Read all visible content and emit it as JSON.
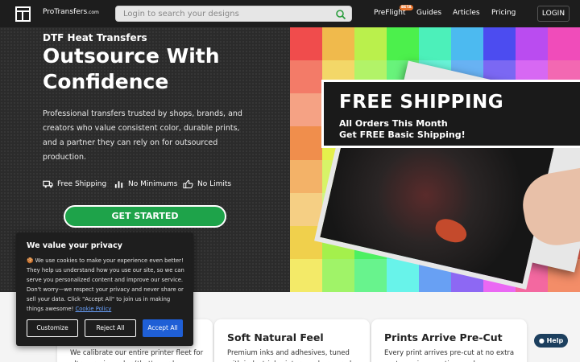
{
  "nav": {
    "logo": "ProTransfers",
    "logo_suffix": ".com",
    "search_placeholder": "Login to search your designs",
    "links": [
      "PreFlight",
      "Guides",
      "Articles",
      "Pricing"
    ],
    "beta_badge": "BETA",
    "login": "LOGIN"
  },
  "hero": {
    "eyebrow": "DTF Heat Transfers",
    "headline": "Outsource With Confidence",
    "description": "Professional transfers trusted by shops, brands, and creators who value consistent color, durable prints, and a partner they can rely on for outsourced production.",
    "features": [
      "Free Shipping",
      "No Minimums",
      "No Limits"
    ],
    "cta": "GET STARTED"
  },
  "promo": {
    "title": "FREE SHIPPING",
    "line1": "All Orders This Month",
    "line2": "Get FREE Basic Shipping!"
  },
  "cookie": {
    "title": "We value your privacy",
    "body": "🍪 We use cookies to make your experience even better! They help us understand how you use our site, so we can serve you personalized content and improve our service. Don't worry—we respect your privacy and never share or sell your data. Click \"Accept All\" to join us in making things awesome!",
    "policy_link": "Cookie Policy",
    "customize": "Customize",
    "reject": "Reject All",
    "accept": "Accept All"
  },
  "cards": [
    {
      "title": "",
      "text": "We calibrate our entire printer fleet for ultra-precise color (that's nerd"
    },
    {
      "title": "Soft Natural Feel",
      "text": "Premium inks and adhesives, tuned with industrial printers and pro-grade"
    },
    {
      "title": "Prints Arrive Pre-Cut",
      "text": "Every print arrives pre-cut at no extra cost—saving you time and"
    }
  ],
  "help": "Help",
  "colors": {
    "nav_bg": "#1d1d1d",
    "hero_bg": "#2b2b2b",
    "cta_green": "#1ea34a",
    "accept_blue": "#1f5fd6",
    "beta_orange": "#e8742c",
    "help_bg": "#1c3f5e"
  }
}
